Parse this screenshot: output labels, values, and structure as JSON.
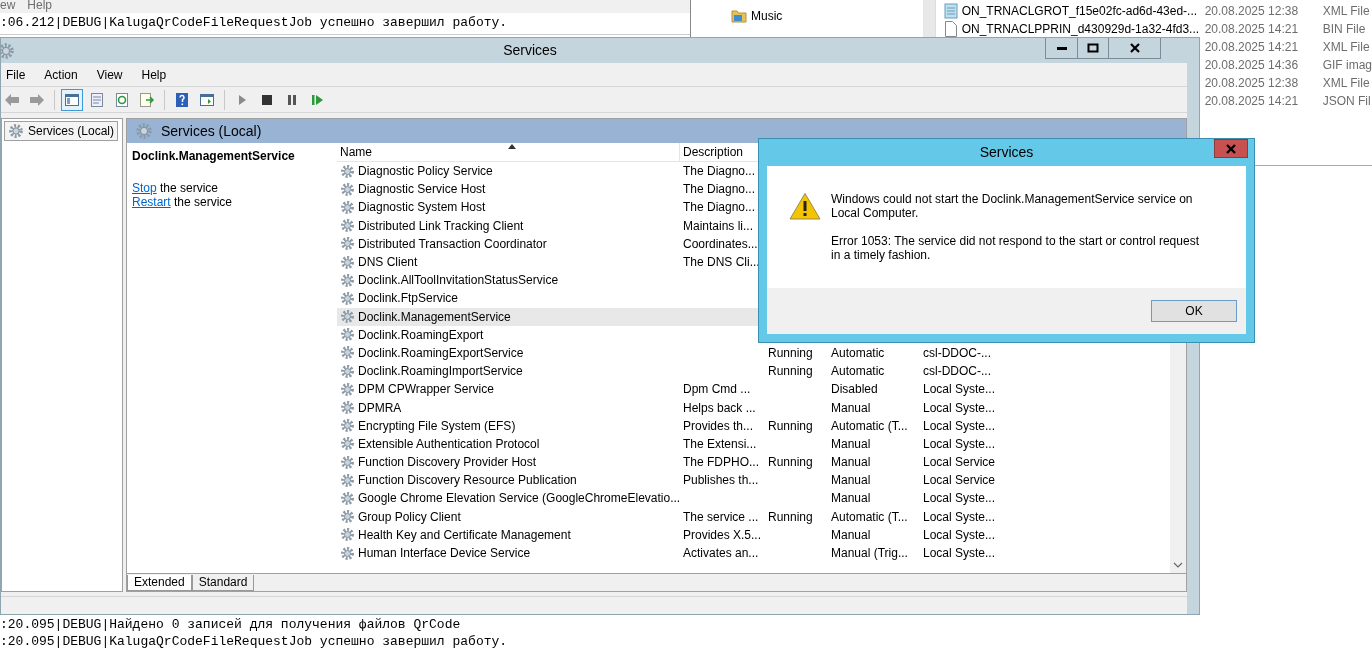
{
  "console": {
    "menu": [
      "ew",
      "Help"
    ],
    "lines_top": [
      ":06.212|DEBUG|KalugaQrCodeFileRequestJob успешно завершил работу."
    ],
    "lines_bottom": [
      ":20.095|DEBUG|Найдено 0 записей для получения файлов QrCode",
      ":20.095|DEBUG|KalugaQrCodeFileRequestJob успешно завершил работу."
    ]
  },
  "explorer": {
    "folders": [
      "Music"
    ],
    "files": [
      {
        "kind": "xml",
        "name": "ON_TRNACLGROT_f15e02fc-ad6d-43ed-...",
        "modified": "20.08.2025 12:38",
        "type": "XML File"
      },
      {
        "kind": "blank",
        "name": "ON_TRNACLPPRIN_d430929d-1a32-4fd3...",
        "modified": "20.08.2025 14:21",
        "type": "BIN File"
      },
      {
        "modified": "20.08.2025 14:21",
        "type": "XML File"
      },
      {
        "modified": "20.08.2025 14:36",
        "type": "GIF imag"
      },
      {
        "modified": "20.08.2025 12:38",
        "type": "XML File"
      },
      {
        "modified": "20.08.2025 14:21",
        "type": "JSON Fil"
      }
    ]
  },
  "services_window": {
    "title": "Services",
    "menu": [
      "File",
      "Action",
      "View",
      "Help"
    ],
    "toolbar": [
      {
        "pressed": false
      },
      {
        "pressed": false
      },
      {
        "pressed": true
      },
      {
        "pressed": false
      },
      {
        "pressed": false
      },
      {
        "pressed": false
      },
      {
        "pressed": false
      },
      {
        "pressed": false
      },
      {
        "pressed": false
      },
      {
        "pressed": false
      },
      {
        "pressed": false
      },
      {
        "pressed": false
      }
    ],
    "tree": [
      {
        "label": "Services (Local)",
        "selected": true
      }
    ],
    "panel_title": "Services (Local)",
    "selected_service": "Doclink.ManagementService",
    "actions": [
      {
        "link": "Stop",
        "text": "the service"
      },
      {
        "link": "Restart",
        "text": "the service"
      }
    ],
    "columns": [
      {
        "label": "Name",
        "sorted": true
      },
      {
        "label": "Description",
        "sorted": false
      }
    ],
    "rows": [
      {
        "name": "Diagnostic Policy Service",
        "description": "The Diagno...",
        "selected": false
      },
      {
        "name": "Diagnostic Service Host",
        "description": "The Diagno...",
        "selected": false
      },
      {
        "name": "Diagnostic System Host",
        "description": "The Diagno...",
        "selected": false
      },
      {
        "name": "Distributed Link Tracking Client",
        "description": "Maintains li...",
        "selected": false
      },
      {
        "name": "Distributed Transaction Coordinator",
        "description": "Coordinates...",
        "selected": false
      },
      {
        "name": "DNS Client",
        "description": "The DNS Cli...",
        "selected": false
      },
      {
        "name": "Doclink.AllToolInvitationStatusService",
        "selected": false
      },
      {
        "name": "Doclink.FtpService",
        "selected": false
      },
      {
        "name": "Doclink.ManagementService",
        "selected": true
      },
      {
        "name": "Doclink.RoamingExport",
        "selected": false
      },
      {
        "name": "Doclink.RoamingExportService",
        "status": "Running",
        "startup_type": "Automatic",
        "log_on_as": "csl-DDOC-...",
        "selected": false
      },
      {
        "name": "Doclink.RoamingImportService",
        "status": "Running",
        "startup_type": "Automatic",
        "log_on_as": "csl-DDOC-...",
        "selected": false
      },
      {
        "name": "DPM CPWrapper Service",
        "description": "Dpm Cmd ...",
        "startup_type": "Disabled",
        "log_on_as": "Local Syste...",
        "selected": false
      },
      {
        "name": "DPMRA",
        "description": "Helps back ...",
        "startup_type": "Manual",
        "log_on_as": "Local Syste...",
        "selected": false
      },
      {
        "name": "Encrypting File System (EFS)",
        "description": "Provides th...",
        "status": "Running",
        "startup_type": "Automatic (T...",
        "log_on_as": "Local Syste...",
        "selected": false
      },
      {
        "name": "Extensible Authentication Protocol",
        "description": "The Extensi...",
        "startup_type": "Manual",
        "log_on_as": "Local Syste...",
        "selected": false
      },
      {
        "name": "Function Discovery Provider Host",
        "description": "The FDPHO...",
        "status": "Running",
        "startup_type": "Manual",
        "log_on_as": "Local Service",
        "selected": false
      },
      {
        "name": "Function Discovery Resource Publication",
        "description": "Publishes th...",
        "startup_type": "Manual",
        "log_on_as": "Local Service",
        "selected": false
      },
      {
        "name": "Google Chrome Elevation Service (GoogleChromeElevatio...",
        "startup_type": "Manual",
        "log_on_as": "Local Syste...",
        "selected": false
      },
      {
        "name": "Group Policy Client",
        "description": "The service ...",
        "status": "Running",
        "startup_type": "Automatic (T...",
        "log_on_as": "Local Syste...",
        "selected": false
      },
      {
        "name": "Health Key and Certificate Management",
        "description": "Provides X.5...",
        "startup_type": "Manual",
        "log_on_as": "Local Syste...",
        "selected": false
      },
      {
        "name": "Human Interface Device Service",
        "description": "Activates an...",
        "startup_type": "Manual (Trig...",
        "log_on_as": "Local Syste...",
        "selected": false
      }
    ],
    "tabs": [
      {
        "label": "Extended",
        "selected": true
      },
      {
        "label": "Standard",
        "selected": false
      }
    ]
  },
  "dialog": {
    "title": "Services",
    "message": [
      "Windows could not start the Doclink.ManagementService service on Local Computer.",
      "Error 1053: The service did not respond to the start or control request in a timely fashion."
    ],
    "button": "OK"
  }
}
